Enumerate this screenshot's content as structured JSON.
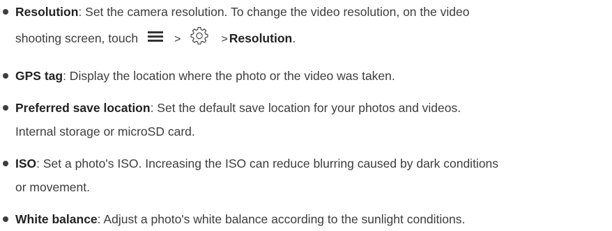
{
  "items": [
    {
      "term": "Resolution",
      "line1": ": Set the camera resolution. To change the video resolution, on the video",
      "line2_prefix": "shooting screen, touch",
      "arrow_1": ">",
      "arrow_2": ">",
      "line2_term": "Resolution",
      "line2_end": ".",
      "icons": [
        "menu-icon",
        "gear-icon"
      ]
    },
    {
      "term": "GPS tag",
      "line1": ": Display the location where the photo or the video was taken."
    },
    {
      "term": "Preferred save location",
      "line1": ": Set the default save location for your photos and videos.",
      "line2": "Internal storage or microSD card."
    },
    {
      "term": "ISO",
      "line1": ": Set a photo's ISO. Increasing the ISO can reduce blurring caused by dark conditions",
      "line2": "or movement."
    },
    {
      "term": "White balance",
      "line1": ": Adjust a photo's white balance according to the sunlight conditions."
    }
  ]
}
